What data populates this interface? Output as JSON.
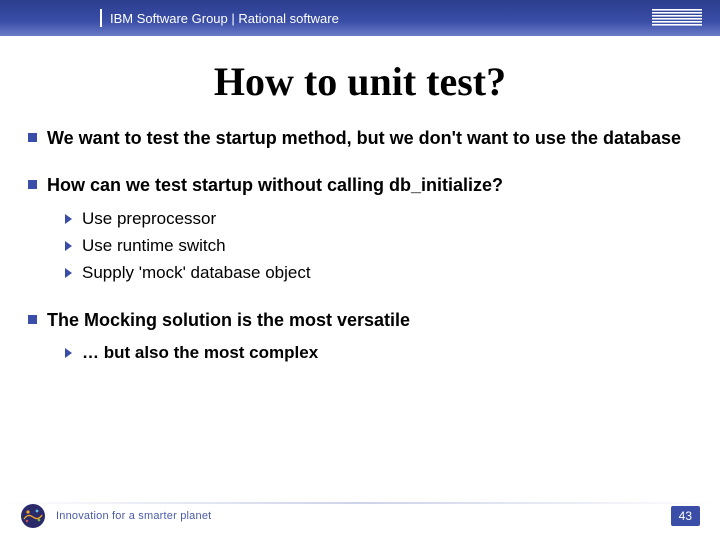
{
  "header": {
    "title": "IBM Software Group | Rational software",
    "logo_name": "ibm-logo"
  },
  "slide": {
    "title": "How to unit test?"
  },
  "bullets": {
    "b1": "We want to test the startup method, but we don't want to use the database",
    "b2": "How can we test startup without calling db_initialize?",
    "b2_children": {
      "c1": "Use preprocessor",
      "c2": "Use runtime switch",
      "c3": "Supply 'mock' database object"
    },
    "b3": "The Mocking solution is the most versatile",
    "b3_children": {
      "c1": "… but also the most complex"
    }
  },
  "footer": {
    "tagline": "Innovation for a smarter planet",
    "page_number": "43"
  }
}
